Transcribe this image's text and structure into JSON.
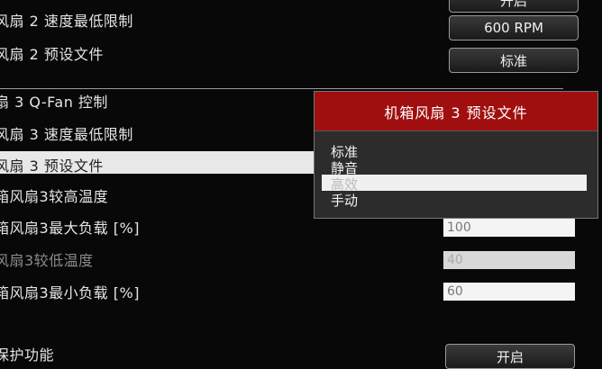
{
  "rows": {
    "fan2_min_speed": "风扇 2 速度最低限制",
    "fan2_profile": "风扇 2 预设文件",
    "fan3_qfan": "扇 3 Q-Fan 控制",
    "fan3_min_speed": "风扇 3 速度最低限制",
    "fan3_profile": "风扇 3 预设文件",
    "fan3_upper_temp": "箱风扇3较高温度",
    "fan3_max_duty": "箱风扇3最大负载 [%]",
    "fan3_lower_temp": "风扇3较低温度",
    "fan3_min_duty": "箱风扇3最小负载 [%]",
    "protection": "保护功能"
  },
  "values": {
    "top_partial": "开启",
    "fan2_min_speed": "600 RPM",
    "fan2_profile": "标准",
    "fan3_max_duty": "100",
    "fan3_lower_temp": "40",
    "fan3_min_duty": "60",
    "protection": "开启"
  },
  "popup": {
    "title": "机箱风扇 3 预设文件",
    "options": [
      "标准",
      "静音",
      "高效",
      "手动"
    ],
    "selected_index": 2
  }
}
